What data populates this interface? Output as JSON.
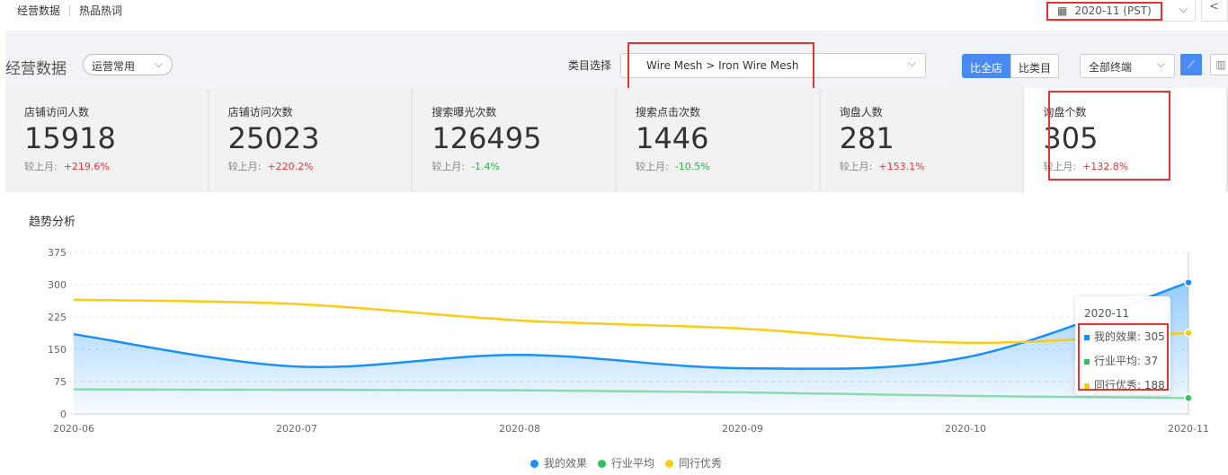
{
  "topnav": {
    "items": [
      "经营数据",
      "热品热词"
    ]
  },
  "date": {
    "value": "2020-11 (PST)",
    "back": "<"
  },
  "header": {
    "title": "经营数据",
    "preset": "运营常用",
    "category_label": "类目选择",
    "category": "Wire Mesh > Iron Wire Mesh",
    "compare": [
      "比全店",
      "比类目"
    ],
    "terminal": "全部终端"
  },
  "cards": [
    {
      "label": "店铺访问人数",
      "value": "15918",
      "cmp_label": "较上月:",
      "cmp": "+219.6%",
      "dir": "up"
    },
    {
      "label": "店铺访问次数",
      "value": "25023",
      "cmp_label": "较上月:",
      "cmp": "+220.2%",
      "dir": "up"
    },
    {
      "label": "搜索曝光次数",
      "value": "126495",
      "cmp_label": "较上月:",
      "cmp": "-1.4%",
      "dir": "down"
    },
    {
      "label": "搜索点击次数",
      "value": "1446",
      "cmp_label": "较上月:",
      "cmp": "-10.5%",
      "dir": "down"
    },
    {
      "label": "询盘人数",
      "value": "281",
      "cmp_label": "较上月:",
      "cmp": "+153.1%",
      "dir": "up"
    },
    {
      "label": "询盘个数",
      "value": "305",
      "cmp_label": "较上月:",
      "cmp": "+132.8%",
      "dir": "up"
    }
  ],
  "trend_title": "趋势分析",
  "chart_data": {
    "type": "line",
    "x": [
      "2020-06",
      "2020-07",
      "2020-08",
      "2020-09",
      "2020-10",
      "2020-11"
    ],
    "ylim": [
      0,
      375
    ],
    "yticks": [
      "0",
      "75",
      "150",
      "225",
      "300",
      "375"
    ],
    "grid": true,
    "legend_position": "bottom",
    "series": [
      {
        "name": "我的效果",
        "color": "#1890ff",
        "values": [
          185,
          110,
          137,
          106,
          131,
          305
        ],
        "area": true
      },
      {
        "name": "行业平均",
        "color": "#2fc25b",
        "values": [
          57,
          56,
          55,
          50,
          42,
          37
        ]
      },
      {
        "name": "同行优秀",
        "color": "#facc14",
        "values": [
          265,
          255,
          217,
          198,
          165,
          188
        ]
      }
    ],
    "tooltip": {
      "title": "2020-11",
      "rows": [
        "我的效果: 305",
        "行业平均: 37",
        "同行优秀: 188"
      ]
    }
  }
}
